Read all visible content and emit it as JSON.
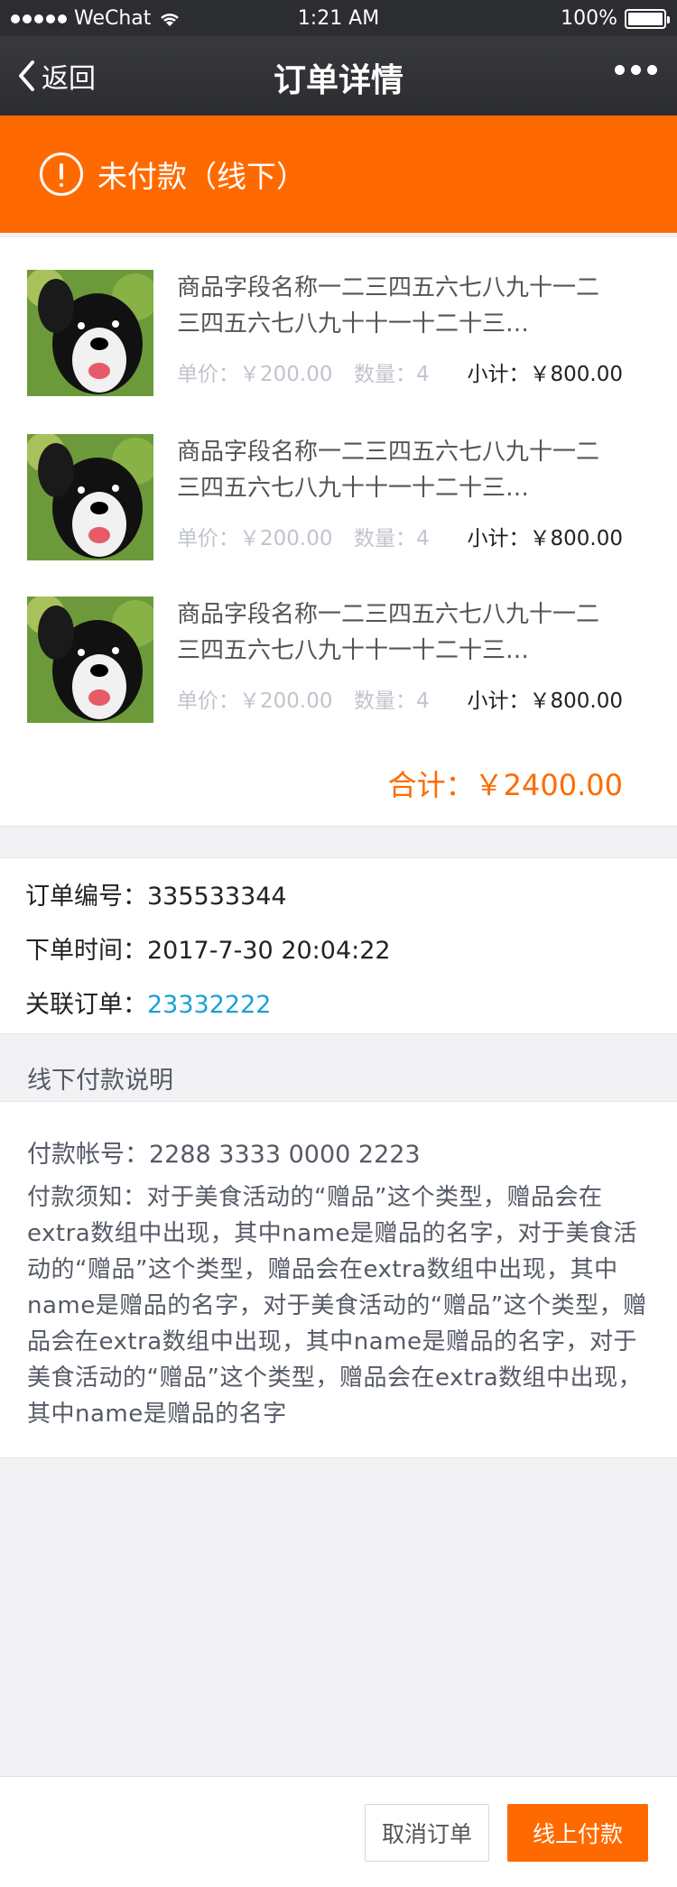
{
  "statusbar": {
    "carrier": "WeChat",
    "time": "1:21 AM",
    "battery": "100%"
  },
  "nav": {
    "back_label": "返回",
    "title": "订单详情"
  },
  "banner": {
    "status_text": "未付款（线下）"
  },
  "products": {
    "items": [
      {
        "name": "商品字段名称一二三四五六七八九十一二三四五六七八九十十一十二十三…",
        "price": "单价：￥200.00",
        "qty": "数量：4",
        "subtotal": "小计：￥800.00"
      },
      {
        "name": "商品字段名称一二三四五六七八九十一二三四五六七八九十十一十二十三…",
        "price": "单价：￥200.00",
        "qty": "数量：4",
        "subtotal": "小计：￥800.00"
      },
      {
        "name": "商品字段名称一二三四五六七八九十一二三四五六七八九十十一十二十三…",
        "price": "单价：￥200.00",
        "qty": "数量：4",
        "subtotal": "小计：￥800.00"
      }
    ],
    "total": "合计：￥2400.00"
  },
  "order": {
    "number_label": "订单编号：",
    "number": "335533344",
    "time_label": "下单时间：",
    "time": "2017-7-30 20:04:22",
    "related_label": "关联订单：",
    "related": "23332222"
  },
  "offline": {
    "section_title": "线下付款说明",
    "account": "付款帐号：2288 3333 0000 2223",
    "notice": "付款须知：对于美食活动的“赠品”这个类型，赠品会在extra数组中出现，其中name是赠品的名字，对于美食活动的“赠品”这个类型，赠品会在extra数组中出现，其中name是赠品的名字，对于美食活动的“赠品”这个类型，赠品会在extra数组中出现，其中name是赠品的名字，对于美食活动的“赠品”这个类型，赠品会在extra数组中出现，其中name是赠品的名字"
  },
  "actions": {
    "cancel_label": "取消订单",
    "pay_label": "线上付款"
  },
  "colors": {
    "accent": "#ff6a00",
    "link": "#1aa0d6",
    "nav": "#2c2d31"
  }
}
